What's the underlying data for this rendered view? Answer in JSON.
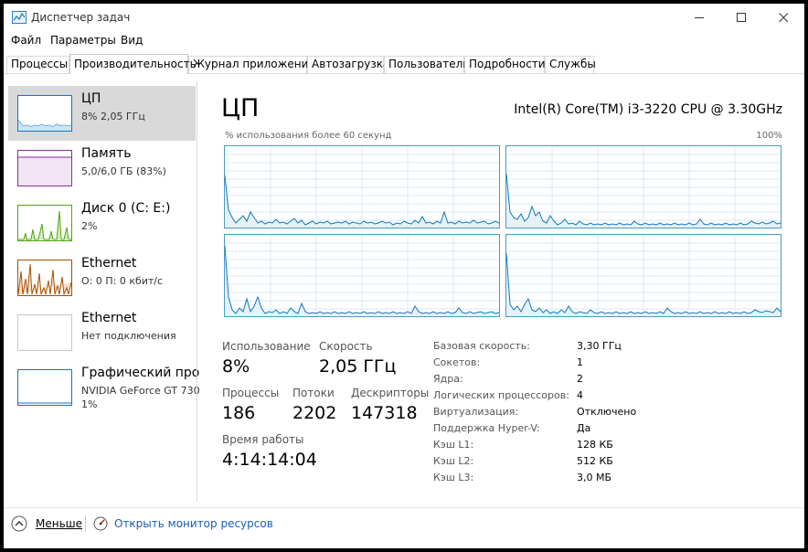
{
  "window": {
    "title": "Диспетчер задач"
  },
  "menu": [
    "Файл",
    "Параметры",
    "Вид"
  ],
  "tabs": [
    "Процессы",
    "Производительность",
    "Журнал приложений",
    "Автозагрузка",
    "Пользователи",
    "Подробности",
    "Службы"
  ],
  "active_tab": "Производительность",
  "sidebar": {
    "items": [
      {
        "title": "ЦП",
        "sub": "8% 2,05 ГГц",
        "sub2": ""
      },
      {
        "title": "Память",
        "sub": "5,0/6,0 ГБ (83%)",
        "sub2": ""
      },
      {
        "title": "Диск 0 (C: E:)",
        "sub": "2%",
        "sub2": ""
      },
      {
        "title": "Ethernet",
        "sub": "О: 0 П: 0 кбит/с",
        "sub2": ""
      },
      {
        "title": "Ethernet",
        "sub": "Нет подключения",
        "sub2": ""
      },
      {
        "title": "Графический про",
        "sub": "NVIDIA GeForce GT 730",
        "sub2": "1%"
      }
    ]
  },
  "main": {
    "heading": "ЦП",
    "model": "Intel(R) Core(TM) i3-3220 CPU @ 3.30GHz",
    "graph_caption": "% использования более 60 секунд",
    "graph_max": "100%",
    "stats": {
      "usage_label": "Использование",
      "usage_value": "8%",
      "speed_label": "Скорость",
      "speed_value": "2,05 ГГц",
      "processes_label": "Процессы",
      "processes_value": "186",
      "threads_label": "Потоки",
      "threads_value": "2202",
      "handles_label": "Дескрипторы",
      "handles_value": "147318",
      "uptime_label": "Время работы",
      "uptime_value": "4:14:14:04"
    },
    "info": [
      {
        "label": "Базовая скорость:",
        "value": "3,30 ГГц"
      },
      {
        "label": "Сокетов:",
        "value": "1"
      },
      {
        "label": "Ядра:",
        "value": "2"
      },
      {
        "label": "Логических процессоров:",
        "value": "4"
      },
      {
        "label": "Виртуализация:",
        "value": "Отключено"
      },
      {
        "label": "Поддержка Hyper-V:",
        "value": "Да"
      },
      {
        "label": "Кэш L1:",
        "value": "128 КБ"
      },
      {
        "label": "Кэш L2:",
        "value": "512 КБ"
      },
      {
        "label": "Кэш L3:",
        "value": "3,0 МБ"
      }
    ]
  },
  "footer": {
    "less_label": "Меньше",
    "resmon_label": "Открыть монитор ресурсов"
  },
  "colors": {
    "cpu": "#1177bb",
    "memory": "#8b2a9b",
    "disk": "#4da60c",
    "ethernet": "#a74f01",
    "graph_border": "#4a9bc4",
    "graph_grid": "#d9eaf4",
    "link": "#1a5fb4"
  },
  "icons": {
    "app": "task-manager-icon",
    "less": "chevron-up-icon",
    "resmon": "resource-monitor-icon"
  }
}
